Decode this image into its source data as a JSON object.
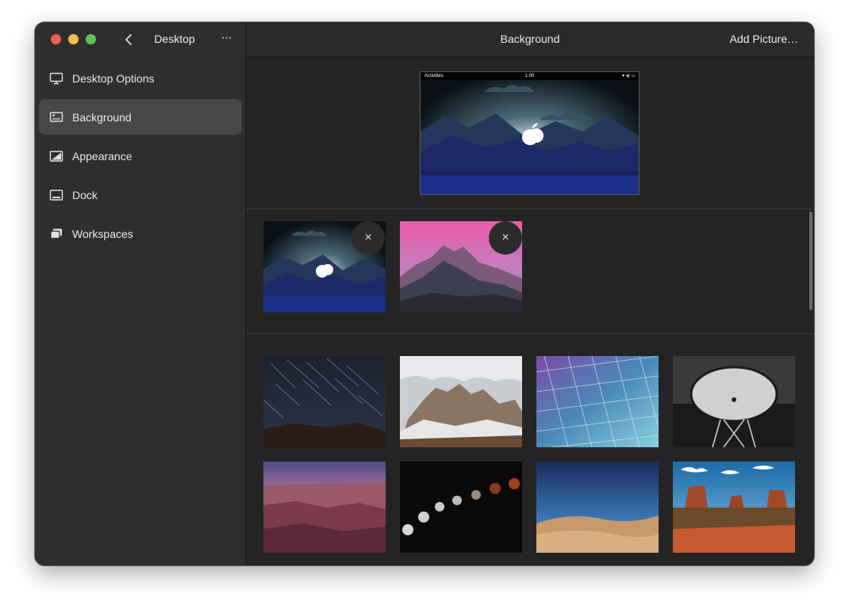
{
  "sidebar": {
    "title": "Desktop",
    "back_icon": "chevron-left-icon",
    "more_label": "···",
    "items": [
      {
        "label": "Desktop Options",
        "icon": "monitor-icon",
        "active": false
      },
      {
        "label": "Background",
        "icon": "wallpaper-icon",
        "active": true
      },
      {
        "label": "Appearance",
        "icon": "appearance-icon",
        "active": false
      },
      {
        "label": "Dock",
        "icon": "dock-icon",
        "active": false
      },
      {
        "label": "Workspaces",
        "icon": "workspaces-icon",
        "active": false
      }
    ]
  },
  "header": {
    "title": "Background",
    "add_button": "Add Picture…"
  },
  "preview": {
    "topbar_left": "Activities",
    "topbar_center": "1:00"
  },
  "custom_wallpapers": [
    {
      "name": "apple-mountains-night",
      "removable": true,
      "remove_label": "×"
    },
    {
      "name": "pink-sky-mountains",
      "removable": true,
      "remove_label": "×"
    }
  ],
  "default_wallpapers": [
    {
      "name": "star-trails"
    },
    {
      "name": "snowy-dolomites"
    },
    {
      "name": "geometric-glass-ceiling"
    },
    {
      "name": "radio-telescope-dish"
    },
    {
      "name": "grand-canyon-sunset"
    },
    {
      "name": "lunar-eclipse-sequence"
    },
    {
      "name": "sand-dunes-night"
    },
    {
      "name": "monument-valley"
    }
  ],
  "colors": {
    "sidebar_bg": "#2e2e2e",
    "main_bg": "#242424",
    "active_item": "#474747",
    "close": "#ed5f57",
    "minimize": "#f4bd4f",
    "zoom": "#5fc453"
  }
}
